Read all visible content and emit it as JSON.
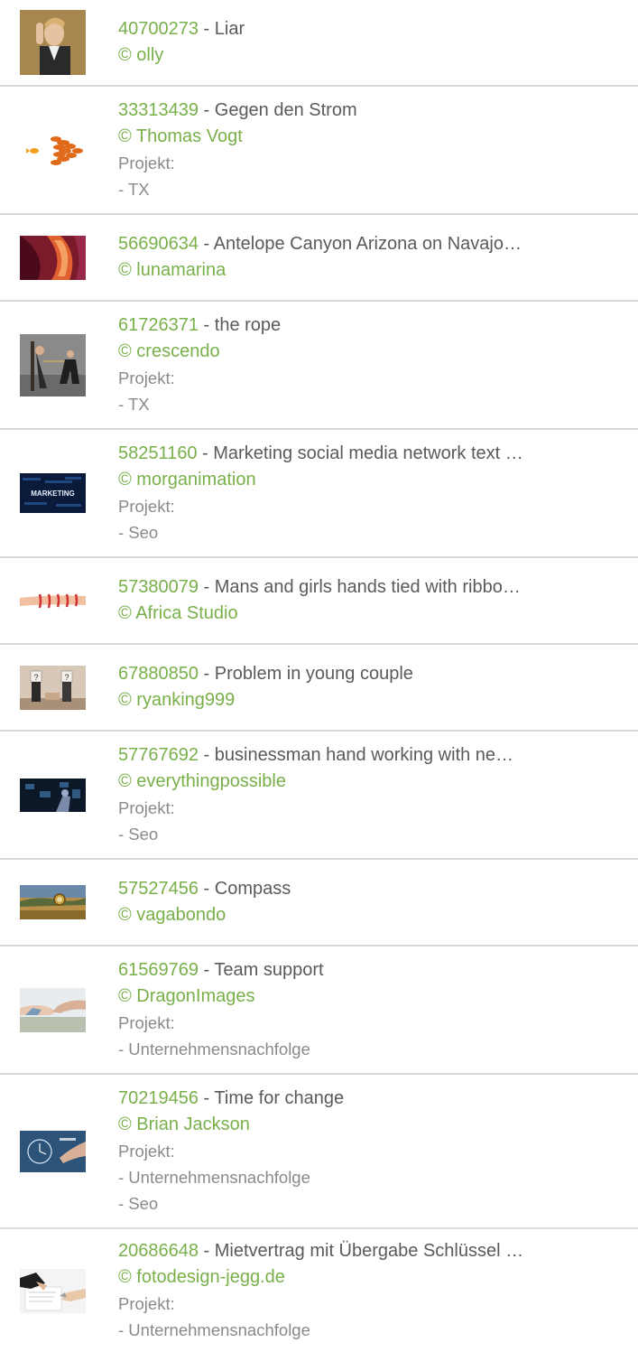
{
  "items": [
    {
      "id": "40700273",
      "title": " - Liar",
      "author": "© olly",
      "projects": []
    },
    {
      "id": "33313439",
      "title": " - Gegen den Strom",
      "author": "© Thomas Vogt",
      "projects": [
        "- TX"
      ]
    },
    {
      "id": "56690634",
      "title": " - Antelope Canyon Arizona on Navajo…",
      "author": "© lunamarina",
      "projects": []
    },
    {
      "id": "61726371",
      "title": " - the rope",
      "author": "© crescendo",
      "projects": [
        "- TX"
      ]
    },
    {
      "id": "58251160",
      "title": " - Marketing social media network text …",
      "author": "© morganimation",
      "projects": [
        "- Seo"
      ]
    },
    {
      "id": "57380079",
      "title": " - Mans and girls hands tied with ribbo…",
      "author": "© Africa Studio",
      "projects": []
    },
    {
      "id": "67880850",
      "title": " - Problem in young couple",
      "author": "© ryanking999",
      "projects": []
    },
    {
      "id": "57767692",
      "title": " - businessman hand working with ne…",
      "author": "© everythingpossible",
      "projects": [
        "- Seo"
      ]
    },
    {
      "id": "57527456",
      "title": " - Compass",
      "author": "© vagabondo",
      "projects": []
    },
    {
      "id": "61569769",
      "title": " - Team support",
      "author": "© DragonImages",
      "projects": [
        "- Unternehmensnachfolge"
      ]
    },
    {
      "id": "70219456",
      "title": " - Time for change",
      "author": "© Brian Jackson",
      "projects": [
        "- Unternehmensnachfolge",
        "- Seo"
      ]
    },
    {
      "id": "20686648",
      "title": " - Mietvertrag mit Übergabe Schlüssel …",
      "author": "© fotodesign-jegg.de",
      "projects": [
        "- Unternehmensnachfolge"
      ]
    }
  ],
  "project_label": "Projekt:",
  "thumb_text_marketing": "MARKETING",
  "colors": {
    "accent": "#79b04a",
    "text": "#5a5a5a",
    "muted": "#8a8a8a",
    "divider": "#d9d9d9"
  }
}
